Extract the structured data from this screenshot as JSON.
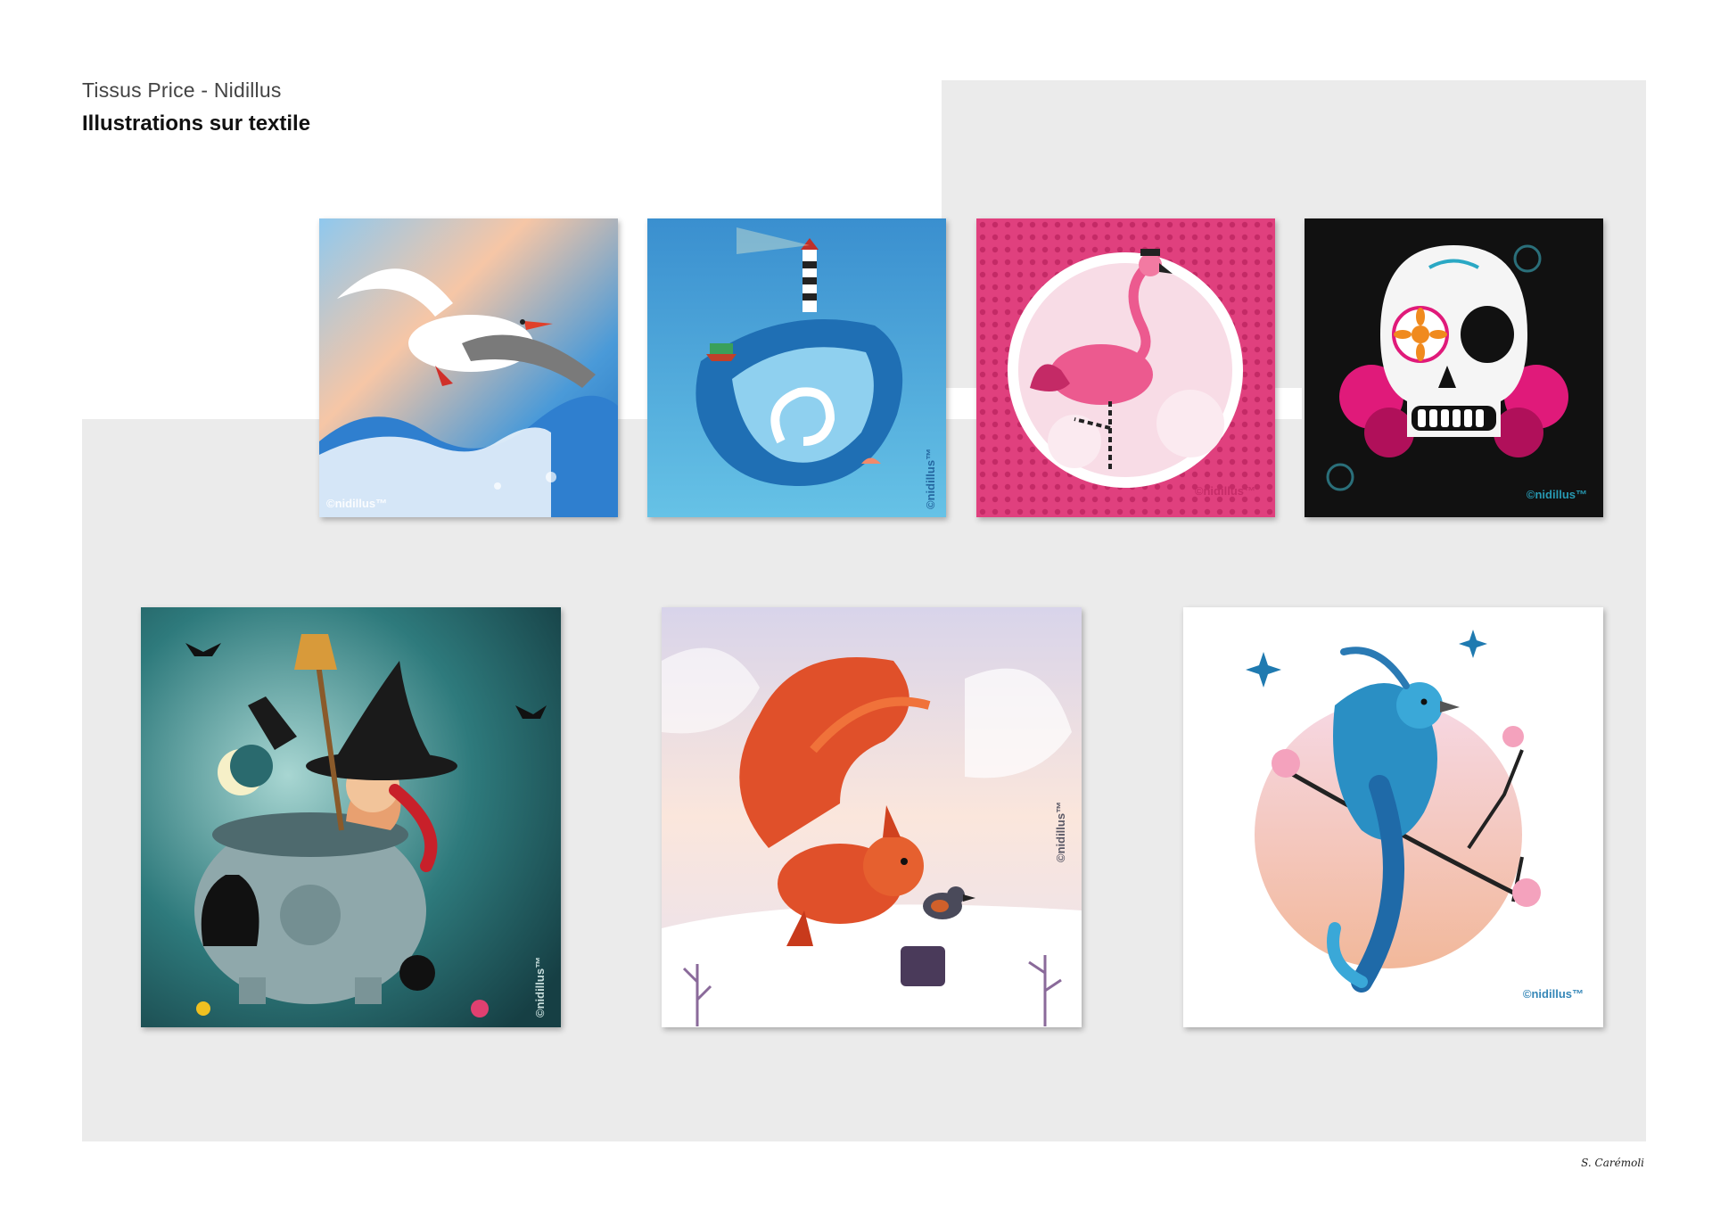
{
  "header": {
    "subtitle": "Tissus Price - Nidillus",
    "title": "Illustrations sur textile"
  },
  "illustrations": [
    {
      "subject": "seagull",
      "watermark": "©nidillus™"
    },
    {
      "subject": "lighthouse-wave",
      "watermark": "©nidillus™"
    },
    {
      "subject": "flamingo",
      "watermark": "©nidillus™"
    },
    {
      "subject": "sugar-skull",
      "watermark": "©nidillus™"
    },
    {
      "subject": "witch-cauldron",
      "watermark": "©nidillus™"
    },
    {
      "subject": "squirrel-bird",
      "watermark": "©nidillus™"
    },
    {
      "subject": "blue-bird-blossom",
      "watermark": "©nidillus™"
    }
  ],
  "signature": "S. Carémoli",
  "colors": {
    "panel_bg": "#ebebeb",
    "seagull_sky": "#5aa6dc",
    "wave_blue": "#1e7ec4",
    "flamingo_pink": "#e0407e",
    "skull_bg": "#111111",
    "witch_teal": "#1e5a5f",
    "squirrel_orange": "#e0502a",
    "bird_blue": "#2a8fc4"
  }
}
